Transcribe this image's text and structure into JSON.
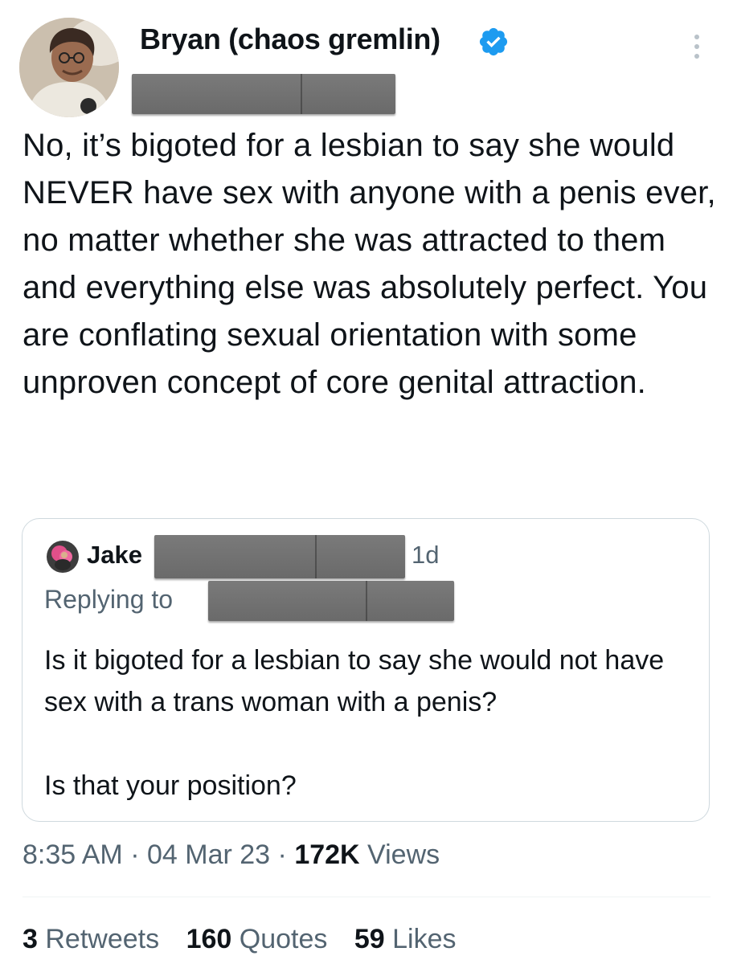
{
  "author": {
    "display_name": "Bryan (chaos gremlin)",
    "verified": true,
    "avatar_icon": "profile-photo"
  },
  "tweet": {
    "text": "No, it’s bigoted for a lesbian to say she would NEVER have sex with anyone with a penis ever, no matter whether she was attracted to them and everything else was absolutely perfect. You are conflating sexual orientation with some unproven concept of core genital attraction."
  },
  "quoted_tweet": {
    "author_name": "Jake",
    "time_ago": "1d",
    "replying_to_label": "Replying to",
    "paragraphs": [
      "Is it bigoted for a lesbian to say she would not have sex with a trans woman with a penis?",
      "Is that your position?"
    ]
  },
  "meta": {
    "time": "8:35 AM",
    "separator": "·",
    "date": "04 Mar 23",
    "views_count": "172K",
    "views_label": "Views"
  },
  "stats": {
    "retweets_count": "3",
    "retweets_label": "Retweets",
    "quotes_count": "160",
    "quotes_label": "Quotes",
    "likes_count": "59",
    "likes_label": "Likes"
  },
  "colors": {
    "text": "#0f1419",
    "secondary": "#536471",
    "verified_blue": "#1d9bf0",
    "border": "#cfd9de",
    "redaction": "#6e6e6e"
  }
}
